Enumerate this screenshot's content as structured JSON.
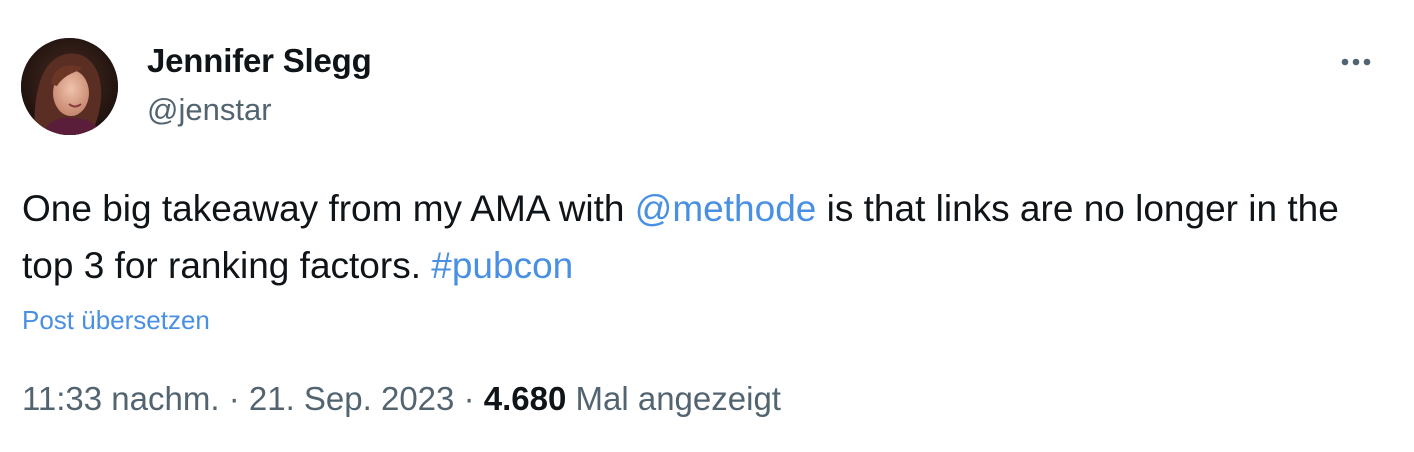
{
  "author": {
    "name": "Jennifer Slegg",
    "handle": "@jenstar"
  },
  "tweet": {
    "text_part1": "One big takeaway from my AMA with ",
    "mention": "@methode",
    "text_part2": " is that links are no longer in the top 3 for ranking factors. ",
    "hashtag": "#pubcon"
  },
  "translate_label": "Post übersetzen",
  "meta": {
    "time": "11:33 nachm.",
    "separator": "·",
    "date": "21. Sep. 2023",
    "views_count": "4.680",
    "views_label": "Mal angezeigt"
  },
  "icons": {
    "more": "more-horizontal-icon"
  },
  "colors": {
    "link": "#4a90e2",
    "secondary_text": "#536471",
    "primary_text": "#0f1419"
  }
}
